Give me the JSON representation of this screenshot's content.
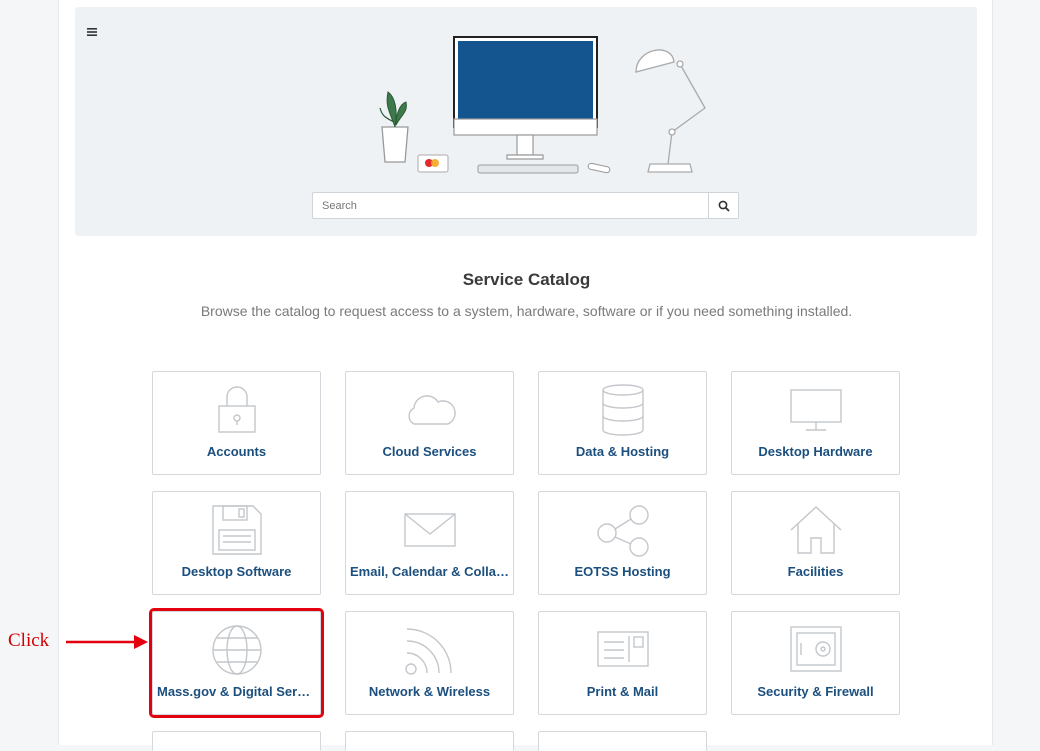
{
  "header": {
    "menu_icon": "hamburger-menu-icon",
    "search": {
      "placeholder": "Search",
      "button_icon": "search-icon"
    }
  },
  "catalog": {
    "title": "Service Catalog",
    "subtitle": "Browse the catalog to request access to a system, hardware, software or if you need something installed.",
    "items": [
      {
        "label": "Accounts",
        "icon": "padlock-icon"
      },
      {
        "label": "Cloud Services",
        "icon": "cloud-icon"
      },
      {
        "label": "Data & Hosting",
        "icon": "database-icon"
      },
      {
        "label": "Desktop Hardware",
        "icon": "monitor-icon"
      },
      {
        "label": "Desktop Software",
        "icon": "floppy-disk-icon"
      },
      {
        "label": "Email, Calendar & Collaboration",
        "icon": "envelope-icon"
      },
      {
        "label": "EOTSS Hosting",
        "icon": "share-nodes-icon"
      },
      {
        "label": "Facilities",
        "icon": "house-icon"
      },
      {
        "label": "Mass.gov & Digital Services",
        "icon": "globe-icon"
      },
      {
        "label": "Network & Wireless",
        "icon": "wifi-signal-icon"
      },
      {
        "label": "Print & Mail",
        "icon": "postcard-icon"
      },
      {
        "label": "Security & Firewall",
        "icon": "safe-icon"
      }
    ]
  },
  "annotation": {
    "text": "Click"
  },
  "colors": {
    "accent": "#1b4f7e",
    "highlight": "#e3000f",
    "monitor_screen": "#14548f"
  }
}
